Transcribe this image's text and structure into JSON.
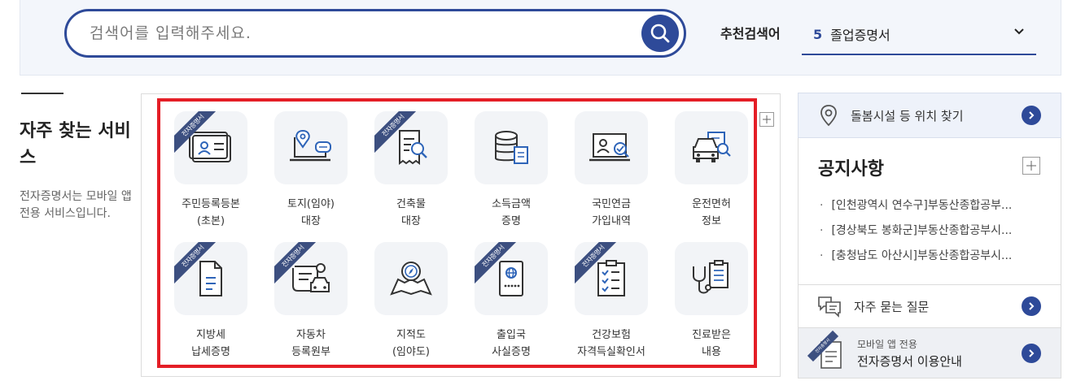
{
  "search": {
    "placeholder": "검색어를 입력해주세요.",
    "recommend_label": "추천검색어",
    "recommend_num": "5",
    "recommend_text": "졸업증명서"
  },
  "left": {
    "title": "자주 찾는 서비스",
    "desc": "전자증명서는 모바일 앱 전용 서비스입니다."
  },
  "services": {
    "ribbon": "전자증명서",
    "items": [
      {
        "l1": "주민등록등본",
        "l2": "(초본)",
        "icon": "id-card-icon"
      },
      {
        "l1": "토지(임야)",
        "l2": "대장",
        "icon": "land-map-laptop-icon"
      },
      {
        "l1": "건축물",
        "l2": "대장",
        "icon": "document-search-icon"
      },
      {
        "l1": "소득금액",
        "l2": "증명",
        "icon": "coin-stack-icon"
      },
      {
        "l1": "국민연금",
        "l2": "가입내역",
        "icon": "laptop-person-icon"
      },
      {
        "l1": "운전면허",
        "l2": "정보",
        "icon": "car-license-icon"
      },
      {
        "l1": "지방세",
        "l2": "납세증명",
        "icon": "document-icon"
      },
      {
        "l1": "자동차",
        "l2": "등록원부",
        "icon": "car-registry-icon"
      },
      {
        "l1": "지적도",
        "l2": "(임야도)",
        "icon": "map-compass-icon"
      },
      {
        "l1": "출입국",
        "l2": "사실증명",
        "icon": "passport-icon"
      },
      {
        "l1": "건강보험",
        "l2": "자격득실확인서",
        "icon": "checklist-icon"
      },
      {
        "l1": "진료받은",
        "l2": "내용",
        "icon": "stethoscope-icon"
      }
    ]
  },
  "right": {
    "location": "돌봄시설 등 위치 찾기",
    "notice_title": "공지사항",
    "notices": [
      "[인천광역시 연수구]부동산종합공부...",
      "[경상북도 봉화군]부동산종합공부시...",
      "[충청남도 아산시]부동산종합공부시..."
    ],
    "faq": "자주 묻는 질문",
    "mobile_small": "모바일 앱 전용",
    "mobile_big": "전자증명서 이용안내",
    "mobile_ribbon": "전자증명서"
  },
  "colors": {
    "primary": "#2e4a99",
    "ribbon": "#3c4f80",
    "highlight_frame": "#e41e26"
  }
}
